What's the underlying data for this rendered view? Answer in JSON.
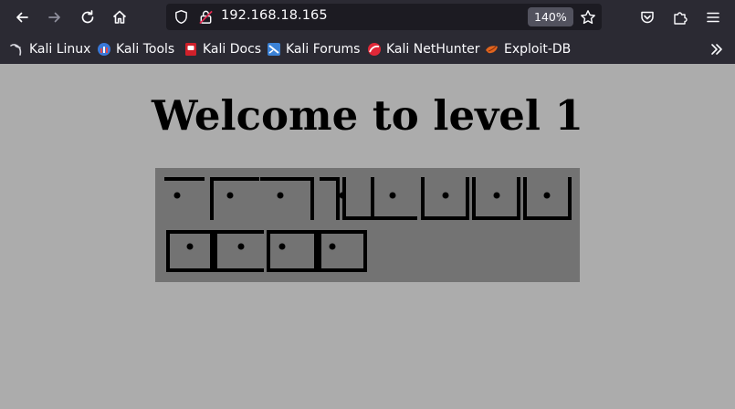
{
  "browser": {
    "url": "192.168.18.165",
    "zoom": "140%",
    "bookmarks": [
      {
        "label": "Kali Linux",
        "icon": "kali-dragon-icon"
      },
      {
        "label": "Kali Tools",
        "icon": "kali-tools-icon"
      },
      {
        "label": "Kali Docs",
        "icon": "kali-docs-icon"
      },
      {
        "label": "Kali Forums",
        "icon": "kali-forums-icon"
      },
      {
        "label": "Kali NetHunter",
        "icon": "kali-nethunter-icon"
      },
      {
        "label": "Exploit-DB",
        "icon": "exploit-db-icon"
      }
    ]
  },
  "page": {
    "heading": "Welcome to level 1",
    "cipher_image": "pigpen-cipher-glyphs"
  },
  "colors": {
    "toolbar_bg": "#2b2a33",
    "urlbar_bg": "#1c1b22",
    "page_bg": "#acacac",
    "cipher_bg": "#737373"
  }
}
